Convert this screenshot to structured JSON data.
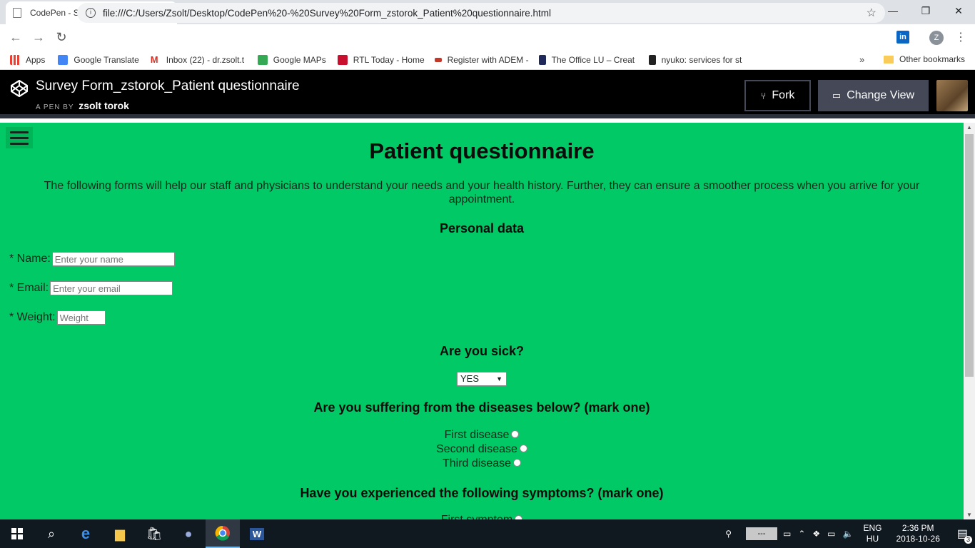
{
  "browser": {
    "tab_title": "CodePen - Survey Form_zstorok_",
    "url": "file:///C:/Users/Zsolt/Desktop/CodePen%20-%20Survey%20Form_zstorok_Patient%20questionnaire.html",
    "profile_initial": "Z",
    "linkedin_label": "in",
    "bookmarks": [
      {
        "label": "Apps",
        "color": "#e94235"
      },
      {
        "label": "Google Translate",
        "color": "#4285f4"
      },
      {
        "label": "Inbox (22) - dr.zsolt.t",
        "color": "#d93025"
      },
      {
        "label": "Google MAPs",
        "color": "#34a853"
      },
      {
        "label": "RTL Today - Home",
        "color": "#c8102e"
      },
      {
        "label": "Register with ADEM -",
        "color": "#c0392b"
      },
      {
        "label": "The Office LU – Creat",
        "color": "#1f2a5a"
      },
      {
        "label": "nyuko: services for st",
        "color": "#222222"
      }
    ],
    "bookmarks_more": "»",
    "other_bookmarks": "Other bookmarks"
  },
  "codepen": {
    "title": "Survey Form_zstorok_Patient questionnaire",
    "by_label": "A PEN BY",
    "author": "zsolt torok",
    "fork_label": "Fork",
    "change_view_label": "Change View"
  },
  "survey": {
    "heading": "Patient questionnaire",
    "intro": "The following forms will help our staff and physicians to understand your needs and your health history. Further, they can ensure a smoother process when you arrive for your appointment.",
    "personal_heading": "Personal data",
    "name_label": "* Name:",
    "name_placeholder": "Enter your name",
    "email_label": "* Email:",
    "email_placeholder": "Enter your email",
    "weight_label": "* Weight:",
    "weight_placeholder": "Weight",
    "sick_heading": "Are you sick?",
    "sick_value": "YES",
    "diseases_heading": "Are you suffering from the diseases below? (mark one)",
    "diseases": [
      "First disease",
      "Second disease",
      "Third disease"
    ],
    "symptoms_heading": "Have you experienced the following symptoms? (mark one)",
    "symptoms_partial": "First symptom"
  },
  "taskbar": {
    "lang_top": "ENG",
    "lang_bottom": "HU",
    "time": "2:36 PM",
    "date": "2018-10-26",
    "notif_count": "3",
    "tray_box": "---"
  }
}
